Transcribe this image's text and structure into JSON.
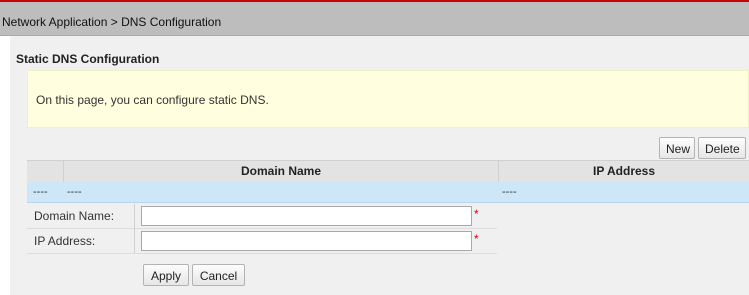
{
  "breadcrumb": {
    "text": "Network Application > DNS Configuration"
  },
  "section": {
    "title": "Static DNS Configuration"
  },
  "info": {
    "text": "On this page, you can configure static DNS."
  },
  "toolbar": {
    "new_label": "New",
    "delete_label": "Delete"
  },
  "table": {
    "columns": [
      "Domain Name",
      "IP Address"
    ],
    "rows": [
      {
        "check": "----",
        "domain": "----",
        "ip": "----"
      }
    ]
  },
  "form": {
    "domain_label": "Domain Name:",
    "domain_value": "",
    "ip_label": "IP Address:",
    "ip_value": "",
    "required_mark": "*",
    "apply_label": "Apply",
    "cancel_label": "Cancel"
  },
  "colors": {
    "accent_line": "#c7000b",
    "info_background": "#ffffe0",
    "selected_row": "#cde6f8",
    "required": "#e00000"
  }
}
